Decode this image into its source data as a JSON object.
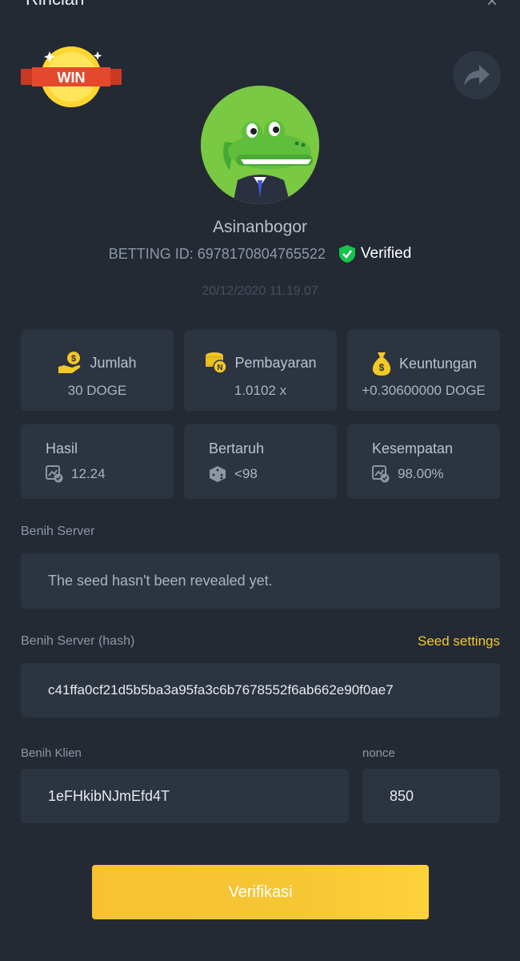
{
  "header": {
    "title": "Rincian",
    "close_icon": "close-icon"
  },
  "badge": {
    "text": "WIN"
  },
  "profile": {
    "username": "Asinanbogor",
    "betting_id_label": "BETTING ID: 6978170804765522",
    "verified_label": "Verified",
    "date": "20/12/2020 11.19.07"
  },
  "stats": {
    "amount": {
      "label": "Jumlah",
      "value": "30 DOGE",
      "icon": "hand-coin-icon"
    },
    "payout": {
      "label": "Pembayaran",
      "value": "1.0102 x",
      "icon": "coin-stack-icon"
    },
    "profit": {
      "label": "Keuntungan",
      "value": "+0.30600000 DOGE",
      "icon": "money-bag-icon"
    },
    "result": {
      "label": "Hasil",
      "value": "12.24",
      "icon": "result-icon"
    },
    "bet": {
      "label": "Bertaruh",
      "value": "<98",
      "icon": "dice-icon"
    },
    "chance": {
      "label": "Kesempatan",
      "value": "98.00%",
      "icon": "chance-icon"
    }
  },
  "server_seed": {
    "label": "Benih Server",
    "message": "The seed hasn't been revealed yet."
  },
  "server_seed_hash": {
    "label": "Benih Server (hash)",
    "settings_link": "Seed settings",
    "value": "c41ffa0cf21d5b5ba3a95fa3c6b7678552f6ab662e90f0ae7"
  },
  "client_seed": {
    "label": "Benih Klien",
    "value": "1eFHkibNJmEfd4T"
  },
  "nonce": {
    "label": "nonce",
    "value": "850"
  },
  "verify_button": {
    "label": "Verifikasi"
  },
  "colors": {
    "background": "#232a34",
    "card": "#2c3440",
    "accent": "#f3c825",
    "verified": "#17c34c"
  }
}
